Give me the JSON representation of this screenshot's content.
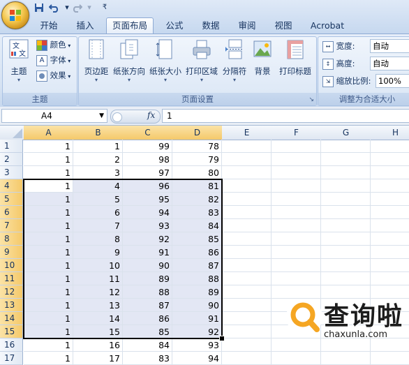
{
  "qat": {
    "save": "save-icon",
    "undo": "undo-icon",
    "redo": "redo-icon",
    "customize": "customize-qat-icon"
  },
  "tabs": [
    "开始",
    "插入",
    "页面布局",
    "公式",
    "数据",
    "审阅",
    "视图",
    "Acrobat"
  ],
  "active_tab": "页面布局",
  "ribbon": {
    "themes": {
      "group_label": "主题",
      "theme_label": "主题",
      "colors_label": "颜色",
      "fonts_label": "字体",
      "effects_label": "效果"
    },
    "page_setup": {
      "group_label": "页面设置",
      "margins": "页边距",
      "orientation": "纸张方向",
      "size": "纸张大小",
      "print_area": "打印区域",
      "breaks": "分隔符",
      "background": "背景",
      "print_titles": "打印标题"
    },
    "scale_to_fit": {
      "group_label": "调整为合适大小",
      "width_label": "宽度:",
      "width_value": "自动",
      "height_label": "高度:",
      "height_value": "自动",
      "scale_label": "缩放比例:",
      "scale_value": "100%"
    }
  },
  "formula_bar": {
    "name_box": "A4",
    "fx": "fx",
    "value": "1"
  },
  "columns": [
    "A",
    "B",
    "C",
    "D",
    "E",
    "F",
    "G",
    "H"
  ],
  "rows": [
    {
      "n": "1",
      "a": "1",
      "b": "1",
      "c": "99",
      "d": "78"
    },
    {
      "n": "2",
      "a": "1",
      "b": "2",
      "c": "98",
      "d": "79"
    },
    {
      "n": "3",
      "a": "1",
      "b": "3",
      "c": "97",
      "d": "80"
    },
    {
      "n": "4",
      "a": "1",
      "b": "4",
      "c": "96",
      "d": "81"
    },
    {
      "n": "5",
      "a": "1",
      "b": "5",
      "c": "95",
      "d": "82"
    },
    {
      "n": "6",
      "a": "1",
      "b": "6",
      "c": "94",
      "d": "83"
    },
    {
      "n": "7",
      "a": "1",
      "b": "7",
      "c": "93",
      "d": "84"
    },
    {
      "n": "8",
      "a": "1",
      "b": "8",
      "c": "92",
      "d": "85"
    },
    {
      "n": "9",
      "a": "1",
      "b": "9",
      "c": "91",
      "d": "86"
    },
    {
      "n": "10",
      "a": "1",
      "b": "10",
      "c": "90",
      "d": "87"
    },
    {
      "n": "11",
      "a": "1",
      "b": "11",
      "c": "89",
      "d": "88"
    },
    {
      "n": "12",
      "a": "1",
      "b": "12",
      "c": "88",
      "d": "89"
    },
    {
      "n": "13",
      "a": "1",
      "b": "13",
      "c": "87",
      "d": "90"
    },
    {
      "n": "14",
      "a": "1",
      "b": "14",
      "c": "86",
      "d": "91"
    },
    {
      "n": "15",
      "a": "1",
      "b": "15",
      "c": "85",
      "d": "92"
    },
    {
      "n": "16",
      "a": "1",
      "b": "16",
      "c": "84",
      "d": "93"
    },
    {
      "n": "17",
      "a": "1",
      "b": "17",
      "c": "83",
      "d": "94"
    }
  ],
  "selection": {
    "from_row": 4,
    "to_row": 15,
    "from_col": "A",
    "to_col": "D"
  },
  "watermark": {
    "title": "查询啦",
    "url": "chaxunla.com",
    "accent": "#f5a623"
  },
  "colors": {
    "ribbon": "#dbe6f4",
    "selection_header": "#f5c96a",
    "selection_fill": "#e3e7f4"
  }
}
